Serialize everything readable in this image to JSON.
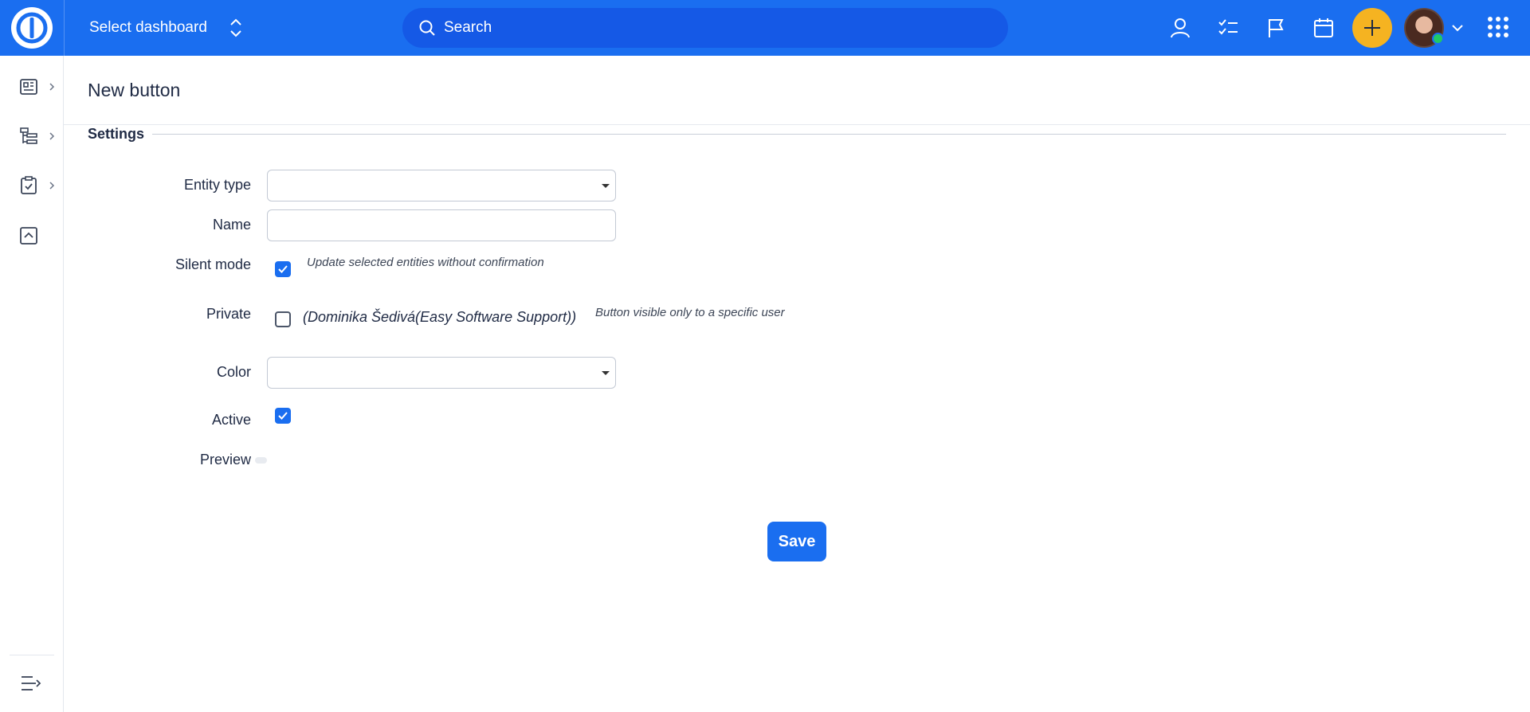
{
  "header": {
    "dashboard_select_label": "Select dashboard",
    "search_placeholder": "Search",
    "brand_color": "#1a6ef0",
    "icons": [
      "user-icon",
      "tasks-icon",
      "flag-icon",
      "calendar-icon",
      "plus-icon",
      "avatar",
      "chevron-down-icon",
      "apps-grid-icon"
    ]
  },
  "sidebar": {
    "items": [
      {
        "icon": "dashboard-icon"
      },
      {
        "icon": "tree-list-icon"
      },
      {
        "icon": "clipboard-check-icon"
      },
      {
        "icon": "collapse-box-icon"
      }
    ],
    "collapse_icon": "menu-collapse-icon"
  },
  "page": {
    "title": "New button",
    "section_legend": "Settings"
  },
  "form": {
    "entity_type_label": "Entity type",
    "entity_type_value": "",
    "name_label": "Name",
    "name_value": "",
    "silent_mode_label": "Silent mode",
    "silent_mode_checked": true,
    "silent_mode_hint": "Update selected entities without confirmation",
    "private_label": "Private",
    "private_checked": false,
    "private_user": "(Dominika Šedivá(Easy Software Support))",
    "private_hint": "Button visible only to a specific user",
    "color_label": "Color",
    "color_value": "",
    "active_label": "Active",
    "active_checked": true,
    "preview_label": "Preview",
    "save_label": "Save"
  }
}
